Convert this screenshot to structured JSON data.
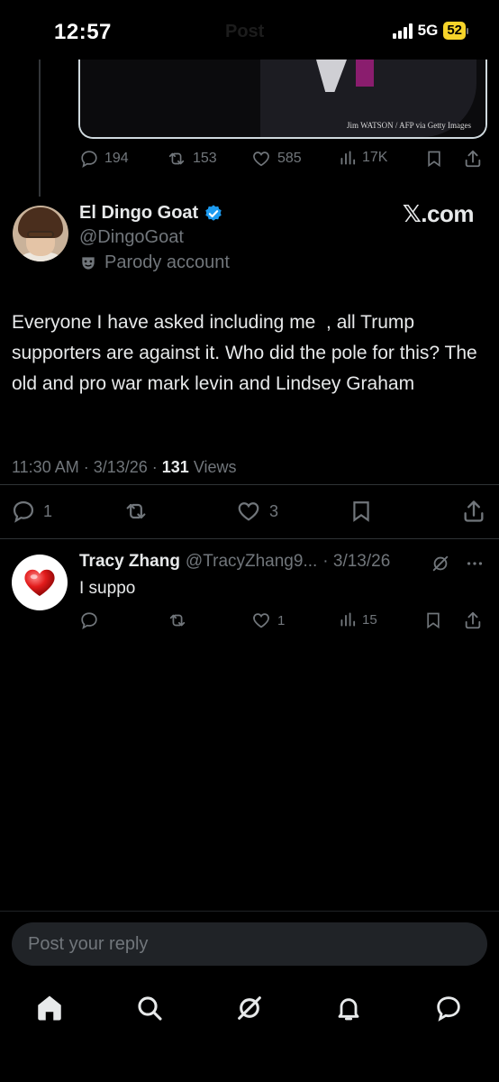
{
  "status_bar": {
    "time": "12:57",
    "faded_title": "Post",
    "network": "5G",
    "battery": "52"
  },
  "previous_post": {
    "photo_credit": "Jim WATSON / AFP via Getty Images",
    "stats": {
      "replies": "194",
      "reposts": "153",
      "likes": "585",
      "views": "17K"
    }
  },
  "main_post": {
    "display_name": "El Dingo Goat",
    "verified": true,
    "handle": "@DingoGoat",
    "parody_label": "Parody account",
    "promo_badge": "𝕏.com",
    "text": "Everyone I have asked including me  , all Trump supporters are against it. Who did the pole for this? The old and pro war mark levin and Lindsey Graham",
    "timestamp": "11:30 AM · 3/13/26 · ",
    "views_count": "131",
    "views_label": " Views",
    "actions": {
      "replies": "1",
      "reposts": "",
      "likes": "3"
    }
  },
  "reply": {
    "display_name": "Tracy Zhang",
    "handle": "@TracyZhang9...",
    "date": "· 3/13/26",
    "text": "I suppo",
    "actions": {
      "replies": "",
      "reposts": "",
      "likes": "1",
      "views": "15"
    }
  },
  "composer": {
    "placeholder": "Post your reply"
  },
  "nav": {
    "items": [
      "home",
      "search",
      "grok",
      "notifications",
      "messages"
    ]
  },
  "colors": {
    "background": "#000000",
    "text_primary": "#e7e9ea",
    "text_secondary": "#71767b",
    "verified_blue": "#1d9bf0",
    "battery_yellow": "#f6d42a"
  }
}
